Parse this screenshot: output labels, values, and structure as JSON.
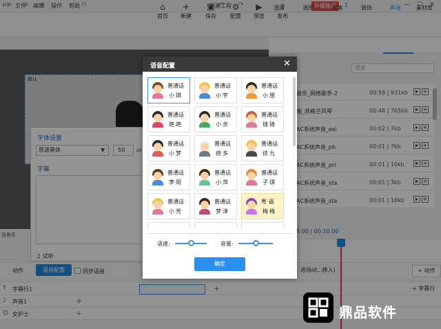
{
  "titlebar": {
    "logo": "H1",
    "menus": [
      "文件",
      "编辑",
      "操作",
      "帮助"
    ],
    "doc_title": "*新建工程",
    "upgrade": "升级账户",
    "account": "1",
    "win": [
      "—",
      "☐",
      "✕"
    ]
  },
  "toolbar": {
    "items": [
      {
        "label": "首页",
        "icon": "home-icon",
        "glyph": "⌂"
      },
      {
        "label": "新建",
        "icon": "new-icon",
        "glyph": "+"
      },
      {
        "label": "保存",
        "icon": "save-icon",
        "glyph": "▣"
      },
      {
        "label": "配置",
        "icon": "gear-icon",
        "glyph": "⚙"
      },
      {
        "label": "预览",
        "icon": "play-icon",
        "glyph": "▶"
      },
      {
        "label": "发布",
        "icon": "publish-icon",
        "glyph": "⇪"
      }
    ]
  },
  "right_panel": {
    "tabs": [
      "图片",
      "图形",
      "文本",
      "装饰",
      "声音",
      "素材库"
    ],
    "active_tab": "声音",
    "search_placeholder": "搜索",
    "rows": [
      {
        "name": "音乐_网络歌手-2",
        "meta": "00:59 | 931kb"
      },
      {
        "name": "曲_苏格兰风琴",
        "meta": "00:48 | 765kb"
      },
      {
        "name": "AC系统声音_exi",
        "meta": "00:02 | 7kb"
      },
      {
        "name": "AC系统声音_ph",
        "meta": "00:01 | 7kb"
      },
      {
        "name": "AC系统声音_pri",
        "meta": "00:01 | 10kb"
      },
      {
        "name": "AC系统声音_sta",
        "meta": "00:01 | 3kb"
      },
      {
        "name": "AC系统声音_sta",
        "meta": "00:01 | 10kb"
      }
    ]
  },
  "scene": {
    "label": "默认"
  },
  "font_panel": {
    "title": "字体设置",
    "font": "思源黑体",
    "size": "50",
    "unit": "pt",
    "subtitle_title": "字幕",
    "listen": "试听"
  },
  "bottom": {
    "bg_label": "背景条",
    "action_label": "动作",
    "voice_config": "语音配置",
    "sync_label": "同步语音",
    "time": "8.00 | 00:10.00",
    "transition": "进场动...移入)",
    "right_action": "+ 动作",
    "tracks": [
      "字幕行1",
      "声音1",
      "女护士"
    ],
    "subtitle_tag": "+ 字幕行"
  },
  "dialog": {
    "title": "语音配置",
    "close": "✕",
    "voices": [
      {
        "cat": "普通话",
        "name": "小琪",
        "hair": "#7a4a2a",
        "body": "#e07a9a",
        "selected": true
      },
      {
        "cat": "普通话",
        "name": "小宇",
        "hair": "#f2c14a",
        "body": "#4a8ad8"
      },
      {
        "cat": "普通话",
        "name": "小朋",
        "hair": "#3a2a1a",
        "body": "#e89a3a"
      },
      {
        "cat": "普通话",
        "name": "艳艳",
        "hair": "#2a2a2a",
        "body": "#d84a6a"
      },
      {
        "cat": "普通话",
        "name": "小余",
        "hair": "#2a2a2a",
        "body": "#4aa86a"
      },
      {
        "cat": "普通话",
        "name": "琦琦",
        "hair": "#c0603a",
        "body": "#e07a9a"
      },
      {
        "cat": "普通话",
        "name": "小梦",
        "hair": "#2a2a2a",
        "body": "#e05a5a"
      },
      {
        "cat": "普通话",
        "name": "徐多",
        "hair": "#f0f0f0",
        "body": "#6a7a8a"
      },
      {
        "cat": "普通话",
        "name": "徐九",
        "hair": "#f2c14a",
        "body": "#4a4a4a"
      },
      {
        "cat": "普通话",
        "name": "李阳",
        "hair": "#5a3a1a",
        "body": "#4a8ad8"
      },
      {
        "cat": "普通话",
        "name": "小萍",
        "hair": "#3a2a1a",
        "body": "#6ac0a0"
      },
      {
        "cat": "普通话",
        "name": "子琪",
        "hair": "#e08a3a",
        "body": "#e07a9a"
      },
      {
        "cat": "普通话",
        "name": "小芳",
        "hair": "#f2c14a",
        "body": "#e07a9a"
      },
      {
        "cat": "普通话",
        "name": "梦淳",
        "hair": "#3a2a1a",
        "body": "#c04a7a"
      },
      {
        "cat": "粤 语",
        "name": "梅梅",
        "hair": "#8a4ac0",
        "body": "#c07ae0",
        "highlight": true
      }
    ],
    "speed_label": "语速:",
    "volume_label": "音量:",
    "speed": 0.5,
    "volume": 0.5,
    "ok": "确定"
  },
  "watermark": {
    "text": "鼎品软件"
  }
}
